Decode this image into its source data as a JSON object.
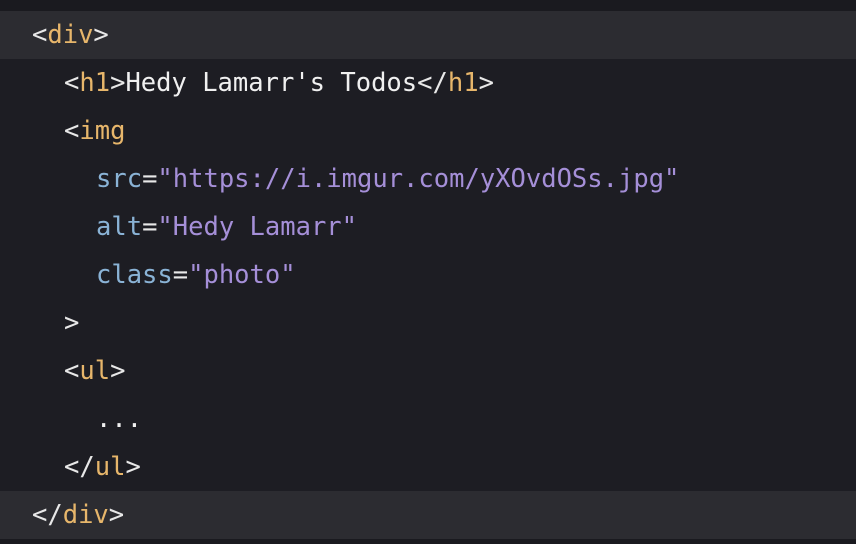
{
  "code_lines": [
    {
      "indent": 0,
      "highlighted": true,
      "tokens": [
        {
          "type": "punc",
          "text": "<"
        },
        {
          "type": "tag",
          "text": "div"
        },
        {
          "type": "punc",
          "text": ">"
        }
      ]
    },
    {
      "indent": 1,
      "highlighted": false,
      "tokens": [
        {
          "type": "punc",
          "text": "<"
        },
        {
          "type": "tag",
          "text": "h1"
        },
        {
          "type": "punc",
          "text": ">"
        },
        {
          "type": "text",
          "text": "Hedy Lamarr's Todos"
        },
        {
          "type": "punc",
          "text": "</"
        },
        {
          "type": "tag",
          "text": "h1"
        },
        {
          "type": "punc",
          "text": ">"
        }
      ]
    },
    {
      "indent": 1,
      "highlighted": false,
      "tokens": [
        {
          "type": "punc",
          "text": "<"
        },
        {
          "type": "tag",
          "text": "img"
        }
      ]
    },
    {
      "indent": 2,
      "highlighted": false,
      "tokens": [
        {
          "type": "attr",
          "text": "src"
        },
        {
          "type": "punc",
          "text": "="
        },
        {
          "type": "str",
          "text": "\"https://i.imgur.com/yXOvdOSs.jpg\""
        }
      ]
    },
    {
      "indent": 2,
      "highlighted": false,
      "tokens": [
        {
          "type": "attr",
          "text": "alt"
        },
        {
          "type": "punc",
          "text": "="
        },
        {
          "type": "str",
          "text": "\"Hedy Lamarr\""
        }
      ]
    },
    {
      "indent": 2,
      "highlighted": false,
      "tokens": [
        {
          "type": "attr",
          "text": "class"
        },
        {
          "type": "punc",
          "text": "="
        },
        {
          "type": "str",
          "text": "\"photo\""
        }
      ]
    },
    {
      "indent": 1,
      "highlighted": false,
      "tokens": [
        {
          "type": "punc",
          "text": ">"
        }
      ]
    },
    {
      "indent": 1,
      "highlighted": false,
      "tokens": [
        {
          "type": "punc",
          "text": "<"
        },
        {
          "type": "tag",
          "text": "ul"
        },
        {
          "type": "punc",
          "text": ">"
        }
      ]
    },
    {
      "indent": 2,
      "highlighted": false,
      "tokens": [
        {
          "type": "text",
          "text": "..."
        }
      ]
    },
    {
      "indent": 1,
      "highlighted": false,
      "tokens": [
        {
          "type": "punc",
          "text": "</"
        },
        {
          "type": "tag",
          "text": "ul"
        },
        {
          "type": "punc",
          "text": ">"
        }
      ]
    },
    {
      "indent": 0,
      "highlighted": true,
      "tokens": [
        {
          "type": "punc",
          "text": "</"
        },
        {
          "type": "tag",
          "text": "div"
        },
        {
          "type": "punc",
          "text": ">"
        }
      ]
    }
  ],
  "colors": {
    "background": "#1d1d23",
    "highlight_line": "#2c2c31",
    "tag": "#e7b66b",
    "attribute": "#8ab3d6",
    "string": "#a58fd8",
    "text": "#f0f0f0"
  }
}
